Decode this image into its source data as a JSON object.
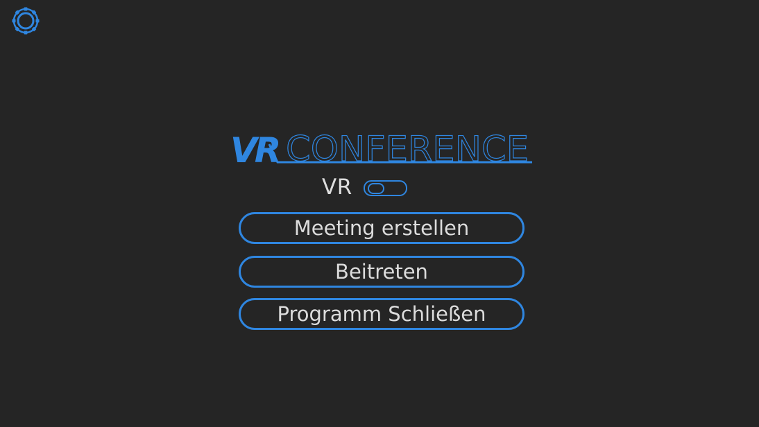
{
  "icons": {
    "settings": "gear-icon"
  },
  "logo": {
    "vr_text": "VR",
    "conference_text": "CONFERENCE"
  },
  "vr_toggle": {
    "label": "VR",
    "state": "off"
  },
  "buttons": {
    "create_meeting": "Meeting erstellen",
    "join": "Beitreten",
    "quit": "Programm Schließen"
  },
  "colors": {
    "background": "#252525",
    "accent": "#2f86e0",
    "text": "#dcdcdc"
  }
}
